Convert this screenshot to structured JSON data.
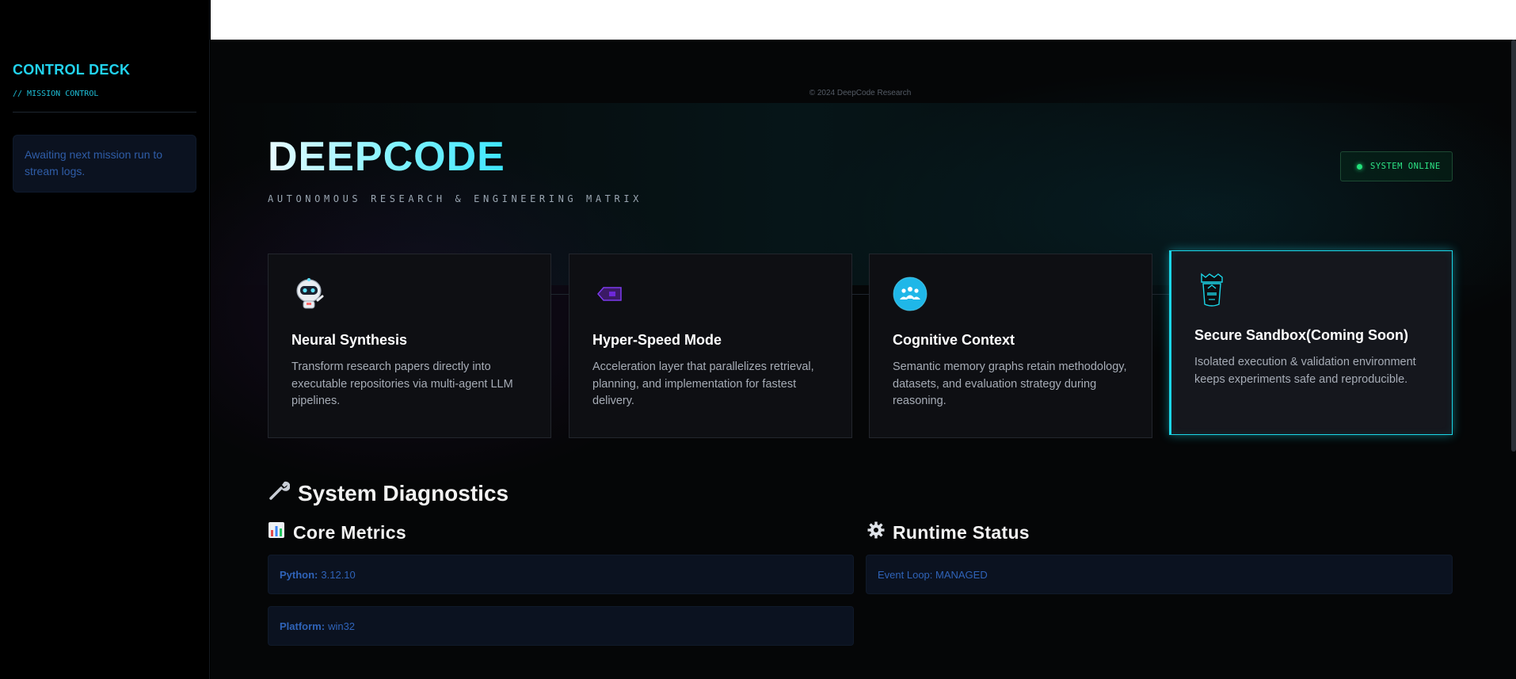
{
  "sidebar": {
    "title": "CONTROL DECK",
    "subtitle": "// MISSION CONTROL",
    "log_message": "Awaiting next mission run to stream logs."
  },
  "footer": {
    "copyright": "© 2024 DeepCode Research"
  },
  "hero": {
    "title": "DEEPCODE",
    "subtitle": "AUTONOMOUS RESEARCH & ENGINEERING MATRIX",
    "status": "SYSTEM ONLINE"
  },
  "features": [
    {
      "icon": "robot-icon",
      "title": "Neural Synthesis",
      "description": "Transform research papers directly into executable repositories via multi-agent LLM pipelines."
    },
    {
      "icon": "tag-icon",
      "title": "Hyper-Speed Mode",
      "description": "Acceleration layer that parallelizes retrieval, planning, and implementation for fastest delivery."
    },
    {
      "icon": "team-icon",
      "title": "Cognitive Context",
      "description": "Semantic memory graphs retain methodology, datasets, and evaluation strategy during reasoning."
    },
    {
      "icon": "sandbox-icon",
      "title": "Secure Sandbox(Coming Soon)",
      "description": "Isolated execution & validation environment keeps experiments safe and reproducible."
    }
  ],
  "diagnostics": {
    "title": "System Diagnostics",
    "core_metrics": {
      "title": "Core Metrics",
      "python_label": "Python:",
      "python_value": "3.12.10",
      "platform_label": "Platform:",
      "platform_value": "win32"
    },
    "runtime_status": {
      "title": "Runtime Status",
      "event_loop": "Event Loop: MANAGED"
    }
  },
  "colors": {
    "accent": "#22d3ee",
    "online": "#22e07a",
    "info_text": "#2f63b8"
  }
}
